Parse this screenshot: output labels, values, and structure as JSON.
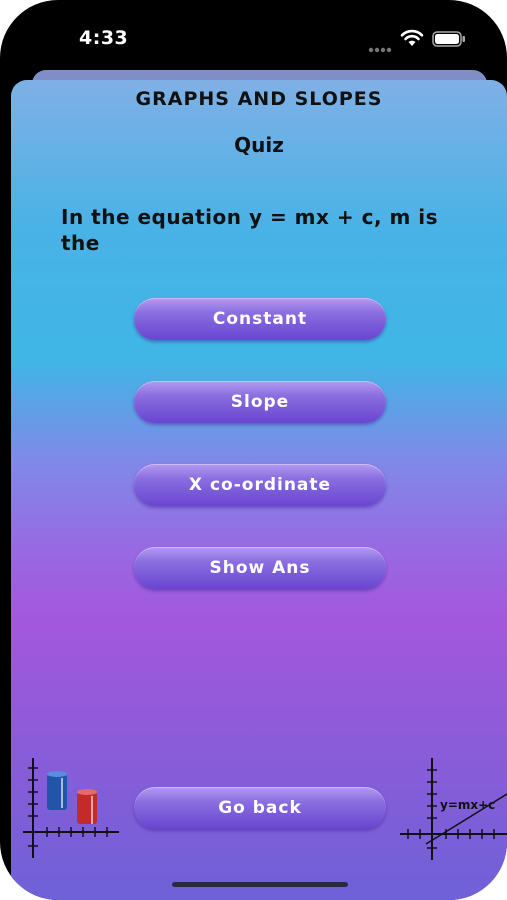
{
  "status_bar": {
    "time": "4:33",
    "icons": [
      "cellular-dots-icon",
      "wifi-icon",
      "battery-icon"
    ]
  },
  "screen": {
    "title": "GRAPHS AND SLOPES",
    "subtitle": "Quiz",
    "question": "In the equation y = mx + c, m is the",
    "options": [
      {
        "label": "Constant"
      },
      {
        "label": "Slope"
      },
      {
        "label": "X co-ordinate"
      }
    ],
    "show_answer_label": "Show Ans",
    "back_label": "Go back",
    "right_graphic_text": "y=mx+c"
  },
  "colors": {
    "button": "#7a5bdc",
    "gradient_top": "#7fb0e6",
    "gradient_mid": "#3fb6e6",
    "gradient_purple": "#a357dd",
    "text": "#111111"
  }
}
